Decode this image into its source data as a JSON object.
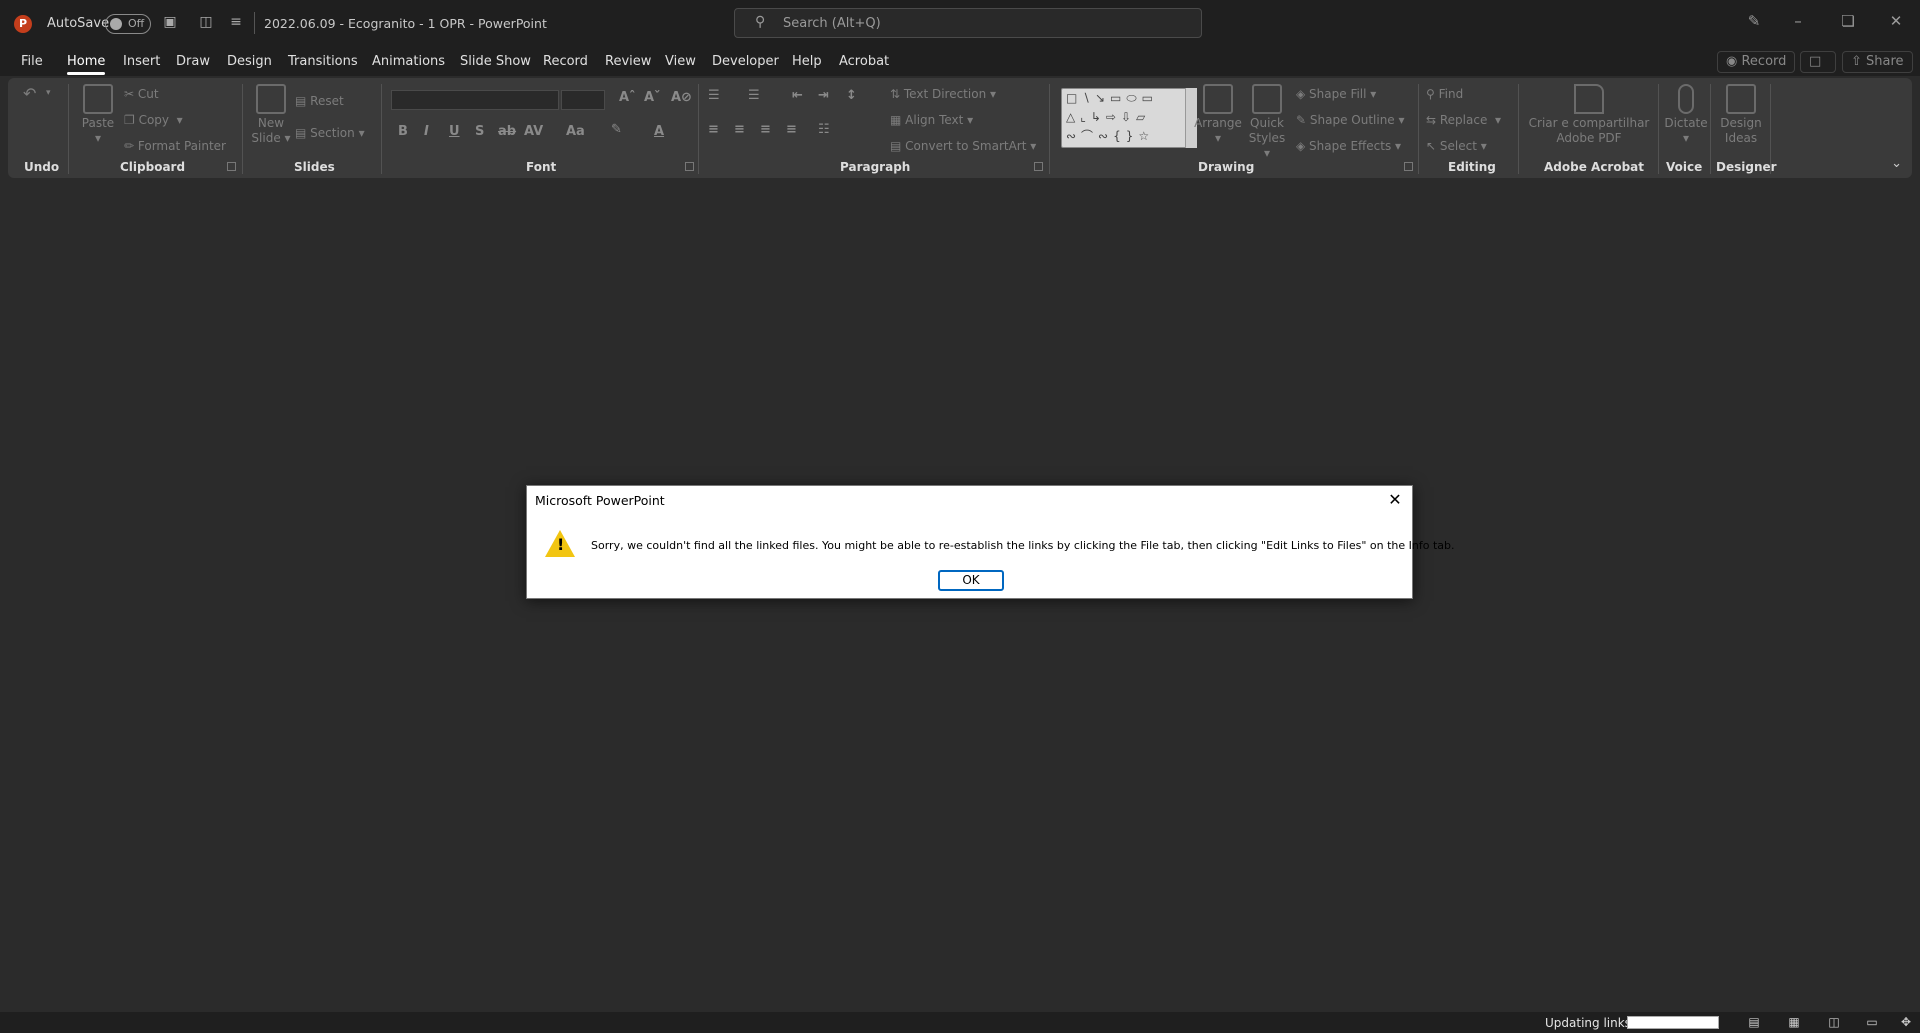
{
  "titlebar": {
    "app_logo": "P",
    "autosave_label": "AutoSave",
    "autosave_state": "Off",
    "doc_title": "2022.06.09 - Ecogranito - 1 OPR  -  PowerPoint",
    "search_placeholder": "Search (Alt+Q)"
  },
  "menu": {
    "tabs": [
      "File",
      "Home",
      "Insert",
      "Draw",
      "Design",
      "Transitions",
      "Animations",
      "Slide Show",
      "Record",
      "Review",
      "View",
      "Developer",
      "Help",
      "Acrobat"
    ],
    "active_tab": "Home",
    "record_button": "Record",
    "share_button": "Share"
  },
  "ribbon": {
    "groups": {
      "undo": "Undo",
      "clipboard": "Clipboard",
      "slides": "Slides",
      "font": "Font",
      "paragraph": "Paragraph",
      "drawing": "Drawing",
      "editing": "Editing",
      "adobe_acrobat": "Adobe Acrobat",
      "voice": "Voice",
      "designer": "Designer"
    },
    "clipboard": {
      "paste": "Paste",
      "cut": "Cut",
      "copy": "Copy",
      "format_painter": "Format Painter"
    },
    "slides": {
      "new_slide_1": "New",
      "new_slide_2": "Slide",
      "reset": "Reset",
      "section": "Section"
    },
    "font": {
      "bold": "B",
      "italic": "I",
      "underline": "U",
      "shadow": "S",
      "strike": "ab",
      "spacing": "AV",
      "case": "Aa"
    },
    "paragraph": {
      "text_direction": "Text Direction",
      "align_text": "Align Text",
      "convert_smartart": "Convert to SmartArt"
    },
    "drawing": {
      "arrange": "Arrange",
      "quick_styles_1": "Quick",
      "quick_styles_2": "Styles",
      "shape_fill": "Shape Fill",
      "shape_outline": "Shape Outline",
      "shape_effects": "Shape Effects"
    },
    "editing": {
      "find": "Find",
      "replace": "Replace",
      "select": "Select"
    },
    "acrobat": {
      "create_1": "Criar e compartilhar",
      "create_2": "Adobe PDF"
    },
    "voice": {
      "dictate": "Dictate"
    },
    "designer": {
      "design_1": "Design",
      "design_2": "Ideas"
    }
  },
  "dialog": {
    "title": "Microsoft PowerPoint",
    "message": "Sorry, we couldn't find all the linked files. You might be able to re-establish the links by clicking the File tab, then clicking \"Edit Links to Files\" on the Info tab.",
    "ok_button": "OK"
  },
  "statusbar": {
    "status_text": "Updating links.",
    "progress": 0
  },
  "colors": {
    "accent": "#c43e1c",
    "warning": "#f2c511",
    "focus": "#0067c0"
  }
}
